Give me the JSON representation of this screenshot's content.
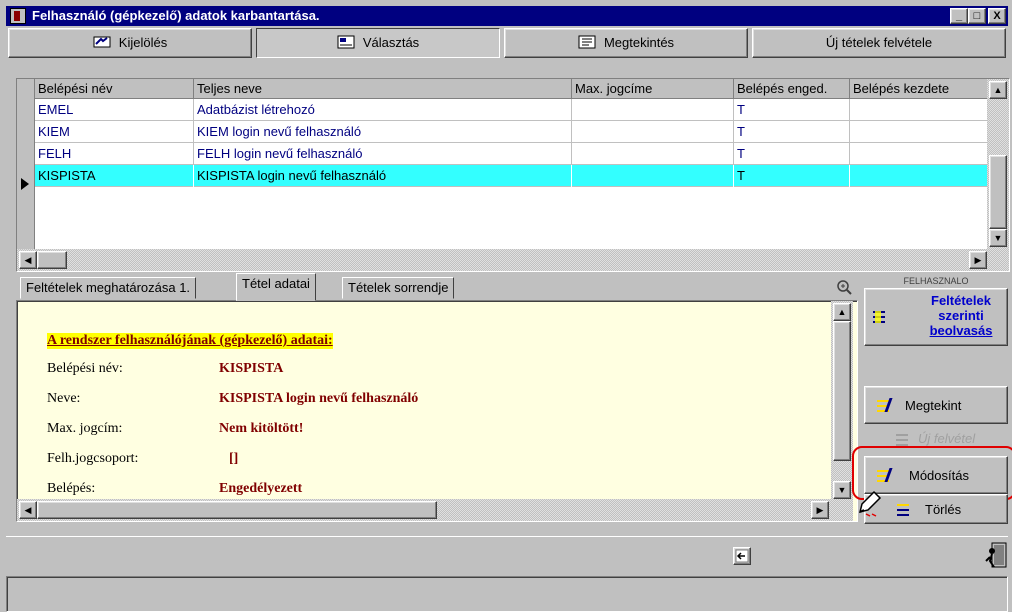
{
  "window": {
    "title": "Felhasználó (gépkezelő) adatok karbantartása.",
    "controls": {
      "minimize": "_",
      "maximize": "□",
      "close": "X"
    }
  },
  "toolbar": {
    "buttons": [
      {
        "label": "Kijelölés",
        "icon": "select-icon"
      },
      {
        "label": "Választás",
        "icon": "choose-icon",
        "pressed": true
      },
      {
        "label": "Megtekintés",
        "icon": "view-icon"
      },
      {
        "label": "Új tételek felvétele"
      }
    ]
  },
  "grid": {
    "columns": [
      "Belépési név",
      "Teljes neve",
      "Max. jogcíme",
      "Belépés enged.",
      "Belépés kezdete"
    ],
    "rows": [
      {
        "login": "EMEL",
        "name": "Adatbázist létrehozó",
        "max": "",
        "enabled": "T",
        "start": ""
      },
      {
        "login": "KIEM",
        "name": "KIEM login nevű felhasználó",
        "max": "",
        "enabled": "T",
        "start": ""
      },
      {
        "login": "FELH",
        "name": "FELH login nevű felhasználó",
        "max": "",
        "enabled": "T",
        "start": ""
      },
      {
        "login": "KISPISTA",
        "name": "KISPISTA login nevű felhasználó",
        "max": "",
        "enabled": "T",
        "start": "",
        "selected": true
      }
    ],
    "selection_color": "#33ffff"
  },
  "tabs": [
    "Feltételek meghatározása 1.",
    "Tétel adatai",
    "Tételek sorrendje"
  ],
  "active_tab": 1,
  "detail": {
    "heading": "A rendszer felhasználójának (gépkezelő) adatai:",
    "fields": [
      {
        "label": "Belépési név:",
        "value": "KISPISTA"
      },
      {
        "label": "Neve:",
        "value": "KISPISTA login nevű felhasználó"
      },
      {
        "label": "Max. jogcím:",
        "value": "Nem kitöltött!"
      },
      {
        "label": "Felh.jogcsoport:",
        "value": "[]"
      },
      {
        "label": "Belépés:",
        "value": "Engedélyezett"
      }
    ]
  },
  "side_panel": {
    "module_label": "FELHASZNALO",
    "load_button": {
      "line1": "Feltételek",
      "line2": "szerinti",
      "line3": "beolvasás"
    },
    "buttons": [
      {
        "label": "Megtekint",
        "enabled": true
      },
      {
        "label": "Új felvétel",
        "enabled": false
      },
      {
        "label": "Módosítás",
        "enabled": true,
        "highlighted": true
      },
      {
        "label": "Törlés",
        "enabled": true
      }
    ]
  },
  "colors": {
    "title_bar": "#000080",
    "detail_bg": "#ffffe1",
    "value_text": "#800000",
    "highlight": "#e00000"
  }
}
